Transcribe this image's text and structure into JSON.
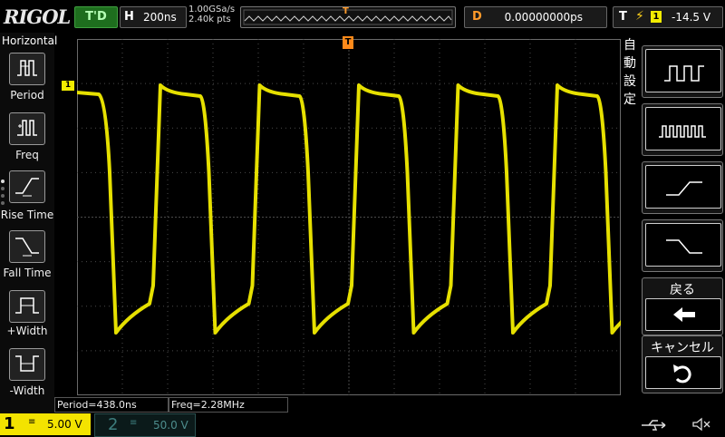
{
  "header": {
    "brand": "RIGOL",
    "trigger_status": "T'D",
    "horizontal_key": "H",
    "timebase": "200ns",
    "sample_rate": "1.00GSa/s",
    "memory_depth": "2.40k pts",
    "trigger_marker": "T",
    "delay_key": "D",
    "delay_value": "0.00000000ps",
    "trigger_key": "T",
    "trigger_edge_glyph": "⚡",
    "trigger_source": "1",
    "trigger_level": "-14.5 V"
  },
  "left_panel": {
    "title": "Horizontal",
    "items": [
      {
        "label": "Period"
      },
      {
        "label": "Freq"
      },
      {
        "label": "Rise Time"
      },
      {
        "label": "Fall Time"
      },
      {
        "label": "+Width"
      },
      {
        "label": "-Width"
      }
    ]
  },
  "right_panel": {
    "title_chars": [
      "自",
      "動",
      "設",
      "定"
    ],
    "back_label": "戻る",
    "cancel_label": "キャンセル",
    "back_icon": "left-arrow-icon",
    "cancel_icon": "undo-icon"
  },
  "screen": {
    "channel_marker": "1",
    "trigger_pos_marker": "T",
    "trace_color": "#f2ec00",
    "grid_color": "#4a4a4a"
  },
  "measurements": {
    "period": "Period=438.0ns",
    "freq": "Freq=2.28MHz"
  },
  "bottom": {
    "ch1": {
      "number": "1",
      "coupling": "≡",
      "scale": "5.00 V"
    },
    "ch2": {
      "number": "2",
      "coupling": "≡",
      "scale": "50.0 V"
    },
    "icons": [
      "usb-icon",
      "speaker-muted-icon"
    ]
  }
}
